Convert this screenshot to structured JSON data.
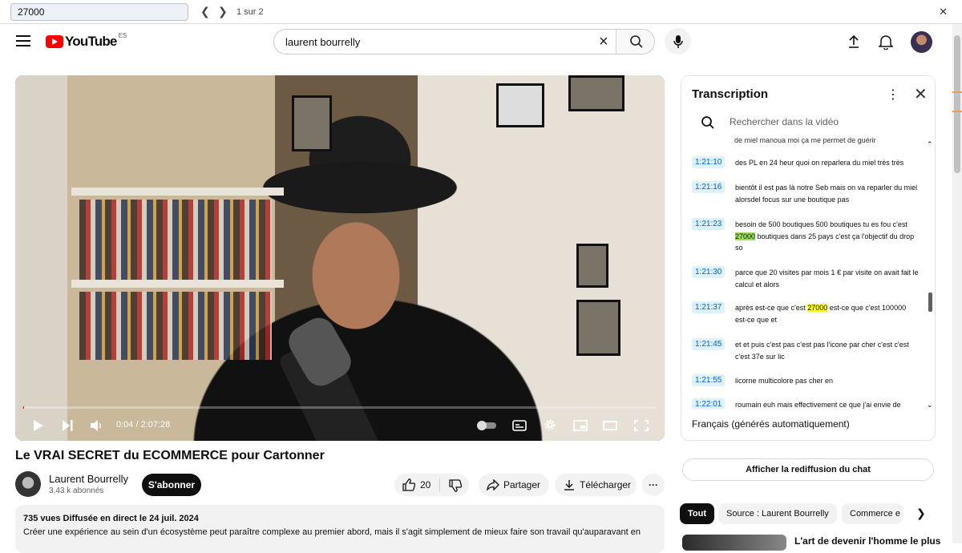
{
  "find_bar": {
    "query": "27000",
    "count": "1 sur 2",
    "prev_icon": "chevron-left-icon",
    "next_icon": "chevron-right-icon"
  },
  "masthead": {
    "logo_text": "YouTube",
    "region": "ES",
    "search_value": "laurent bourrelly"
  },
  "player": {
    "time": "0:04 / 2:07:28",
    "progress": 0.0005
  },
  "video": {
    "title": "Le VRAI SECRET du ECOMMERCE pour Cartonner",
    "channel": "Laurent Bourrelly",
    "subscribers": "3,43 k abonnés",
    "subscribe_label": "S'abonner",
    "likes": "20",
    "share_label": "Partager",
    "download_label": "Télécharger",
    "description_meta": "735 vues  Diffusée en direct le 24 juil. 2024",
    "description_text": "Créer une expérience au sein d'un écosystème peut paraître complexe au premier abord, mais il s'agit simplement de mieux faire son travail qu'auparavant en"
  },
  "transcript": {
    "title": "Transcription",
    "search_placeholder": "Rechercher dans la vidéo",
    "cut_line": "de miel manoua moi ça me permet de guérir",
    "segments": [
      {
        "ts": "1:21:10",
        "before": "des PL en 24 heur quoi on reparlera du miel très très",
        "hl": "",
        "after": ""
      },
      {
        "ts": "1:21:16",
        "before": "bientôt il est pas là notre Seb mais on va reparler du miel alorsdel focus sur une boutique pas",
        "hl": "",
        "after": ""
      },
      {
        "ts": "1:21:23",
        "before": "besoin de 500 boutiques 500 boutiques tu es fou c'est ",
        "hl": "27000",
        "after": " boutiques dans 25 pays c'est ça l'objectif du drop so"
      },
      {
        "ts": "1:21:30",
        "before": "parce que 20 visites par mois 1 € par visite on avait fait le calcul et alors",
        "hl": "",
        "after": ""
      },
      {
        "ts": "1:21:37",
        "before": "après est-ce que c'est ",
        "hl": "27000",
        "after": " est-ce que c'est 100000 est-ce que et"
      },
      {
        "ts": "1:21:45",
        "before": "et et puis c'est pas c'est pas l'icone par cher c'est c'est c'est 37e sur lic",
        "hl": "",
        "after": ""
      },
      {
        "ts": "1:21:55",
        "before": "licorne multicolore pas cher en",
        "hl": "",
        "after": ""
      },
      {
        "ts": "1:22:01",
        "before": "roumain euh mais effectivement ce que j'ai envie de",
        "hl": "",
        "after": ""
      }
    ],
    "language": "Français (générés automatiquement)"
  },
  "sidebar": {
    "chat_replay": "Afficher la rediffusion du chat",
    "chips": [
      "Tout",
      "Source : Laurent Bourrelly",
      "Commerce e"
    ],
    "rec_title": "L'art de devenir l'homme le plus"
  }
}
